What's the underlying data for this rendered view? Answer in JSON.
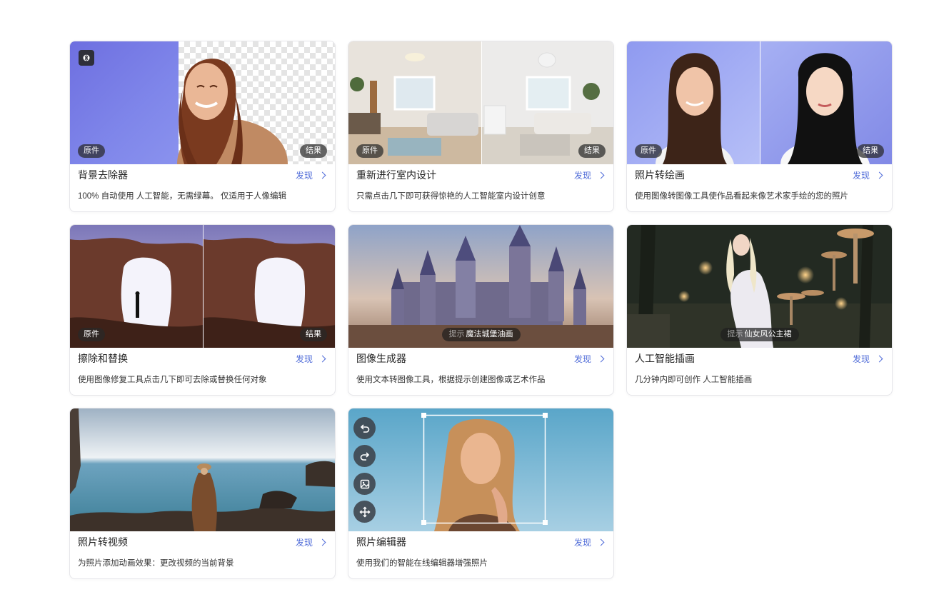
{
  "labels": {
    "original": "原件",
    "result": "结果",
    "discover": "发现"
  },
  "cards": [
    {
      "title": "背景去除器",
      "desc": "100% 自动使用 人工智能，无需绿幕。 仅适用于人像编辑"
    },
    {
      "title": "重新进行室内设计",
      "desc": "只需点击几下即可获得惊艳的人工智能室内设计创意"
    },
    {
      "title": "照片转绘画",
      "desc": "使用图像转图像工具使作品看起来像艺术家手绘的您的照片"
    },
    {
      "title": "擦除和替换",
      "desc": "使用图像修复工具点击几下即可去除或替换任何对象"
    },
    {
      "title": "图像生成器",
      "desc": "使用文本转图像工具，根据提示创建图像或艺术作品",
      "prompt_label": "提示",
      "prompt": "魔法城堡油画"
    },
    {
      "title": "人工智能插画",
      "desc": "几分钟内即可创作 人工智能插画",
      "prompt_label": "提示",
      "prompt": "仙女风公主裙"
    },
    {
      "title": "照片转视频",
      "desc": "为照片添加动画效果：更改视频的当前背景"
    },
    {
      "title": "照片编辑器",
      "desc": "使用我们的智能在线编辑器增强照片"
    }
  ],
  "colors": {
    "link": "#4f6bd8",
    "tag_bg": "#2d2d2d"
  },
  "icons": [
    "ai-badge-icon",
    "chevron-right-icon",
    "undo-icon",
    "redo-icon",
    "image-icon",
    "move-icon"
  ]
}
